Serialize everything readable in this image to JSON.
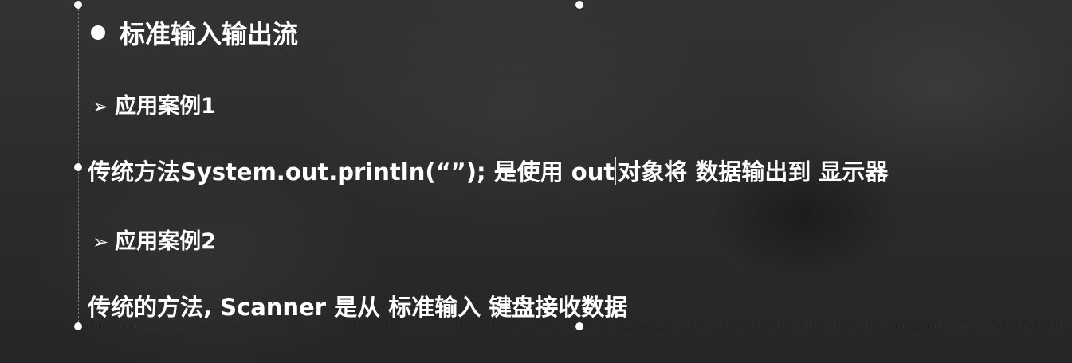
{
  "slide": {
    "heading": "标准输入输出流",
    "case1_label": "应用案例1",
    "body1_before_caret": "传统方法System.out.println(“”); 是使用 out",
    "body1_after_caret": "对象将 数据输出到 显示器",
    "case2_label": "应用案例2",
    "body2": "传统的方法, Scanner 是从 标准输入 键盘接收数据"
  },
  "icons": {
    "heading_bullet": "filled-circle-bullet",
    "case_marker": "arrow-bullet",
    "margin_bullet": "small-dot-bullet"
  },
  "colors": {
    "text": "#ffffff",
    "background": "#2e2e2e"
  }
}
